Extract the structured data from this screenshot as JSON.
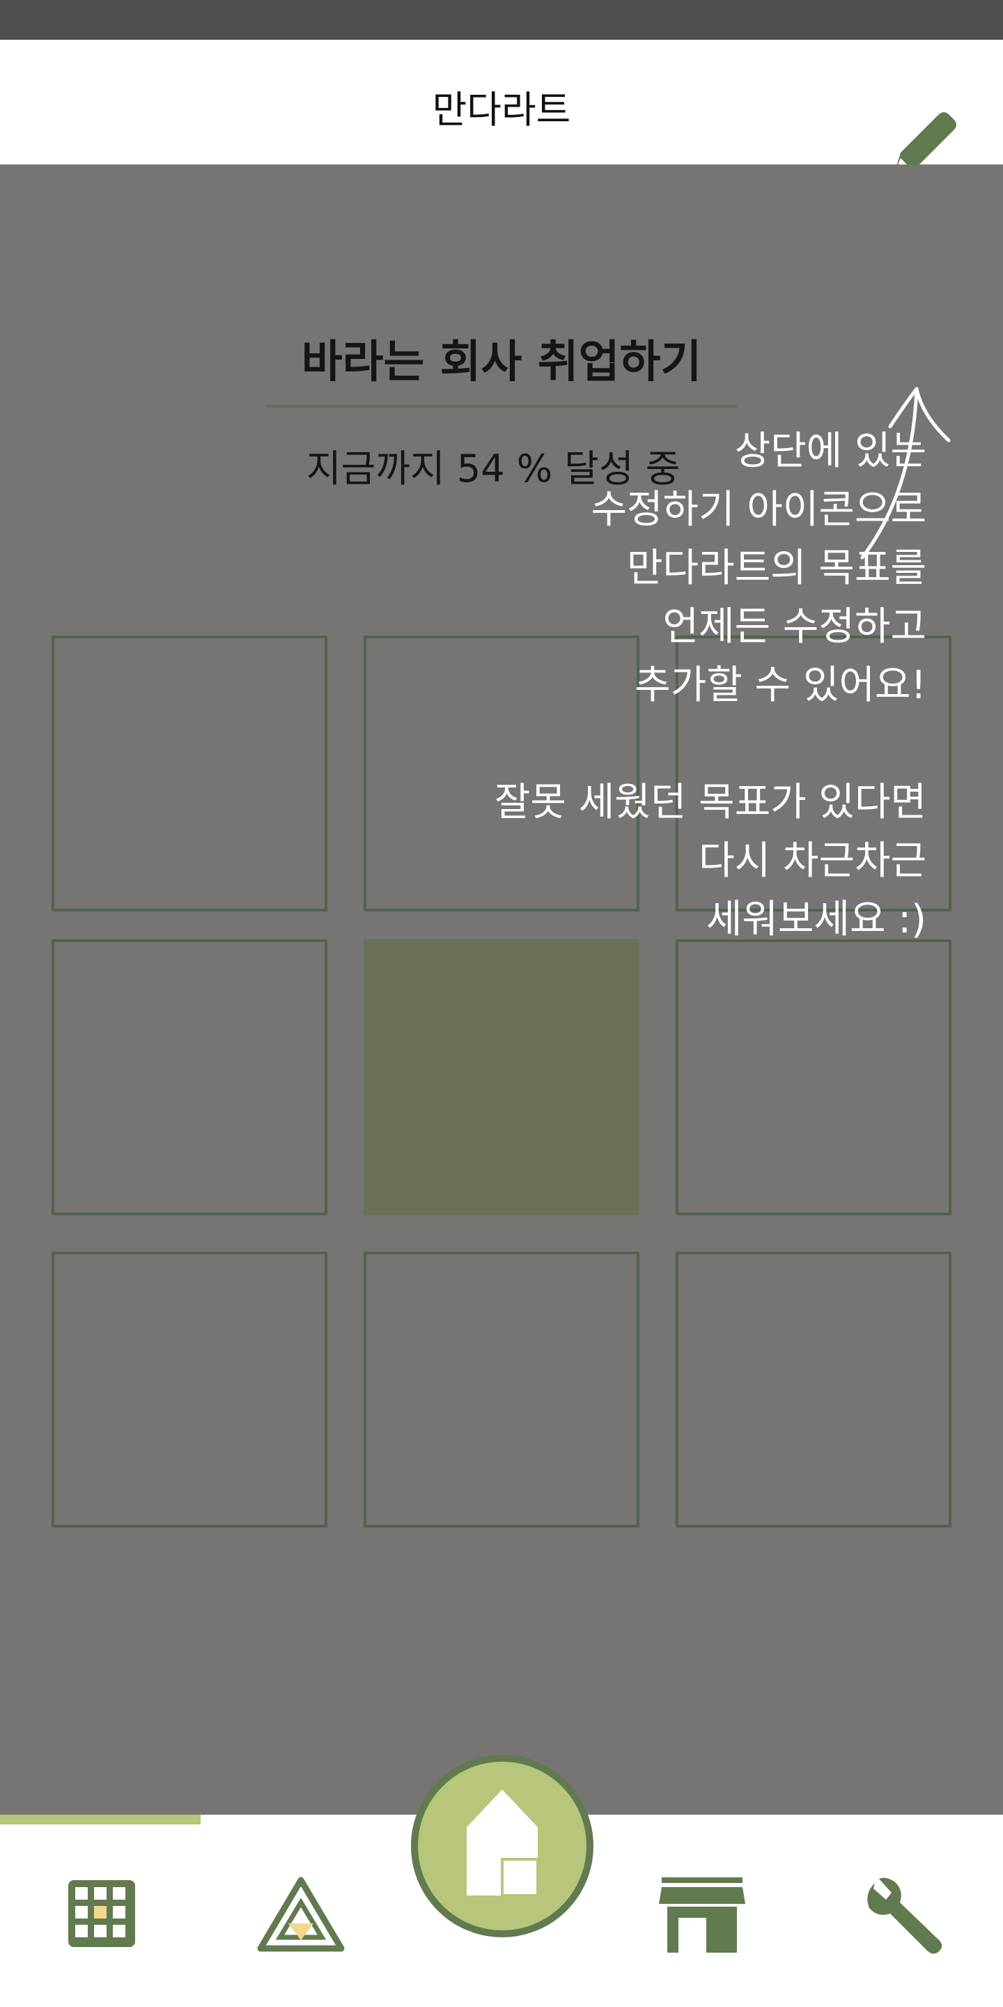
{
  "header": {
    "title": "만다라트"
  },
  "goal": {
    "title": "바라는 회사 취업하기",
    "progress_prefix": "지금까지",
    "progress_value": "54",
    "progress_suffix": "% 달성 중"
  },
  "tutorial": {
    "lines": [
      "상단에 있는",
      "수정하기 아이콘으로",
      "만다라트의 목표를",
      "언제든 수정하고",
      "추가할 수 있어요!",
      "",
      "잘못 세웠던 목표가 있다면",
      "다시 차근차근",
      "세워보세요 :)"
    ]
  },
  "nav": {
    "items": [
      {
        "icon": "grid-icon"
      },
      {
        "icon": "triangle-icon"
      },
      {
        "icon": "home-icon"
      },
      {
        "icon": "store-icon"
      },
      {
        "icon": "wrench-icon"
      }
    ],
    "active_index": 0
  },
  "colors": {
    "accent": "#5e7452",
    "light_accent": "#b7c67b",
    "overlay": "#767574"
  }
}
